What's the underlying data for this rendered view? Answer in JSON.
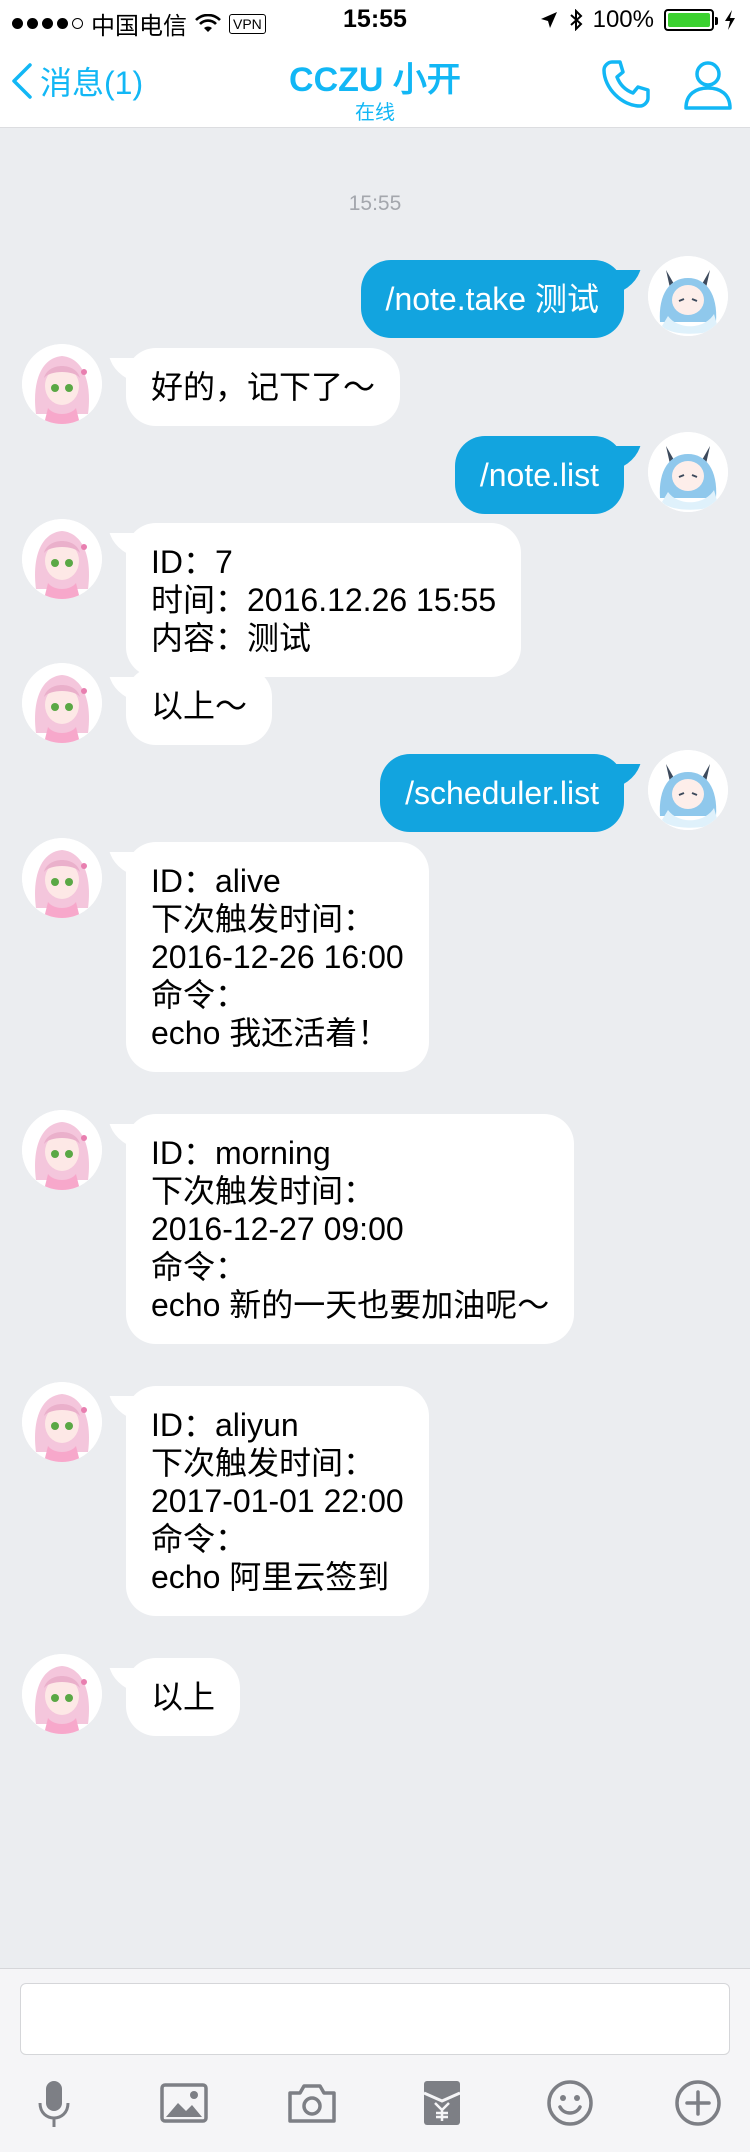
{
  "status_bar": {
    "carrier": "中国电信",
    "vpn": "VPN",
    "time": "15:55",
    "battery": "100%",
    "battery_level": 1.0
  },
  "nav": {
    "back_label": "消息(1)",
    "title": "CCZU 小开",
    "subtitle": "在线"
  },
  "chat": {
    "timestamp": "15:55",
    "messages": [
      {
        "side": "right",
        "text": "/note.take 测试"
      },
      {
        "side": "left",
        "text": "好的，记下了～"
      },
      {
        "side": "right",
        "text": "/note.list"
      },
      {
        "side": "left",
        "text": "ID：7\n时间：2016.12.26 15:55\n内容：测试"
      },
      {
        "side": "left",
        "text": "以上～"
      },
      {
        "side": "right",
        "text": "/scheduler.list"
      },
      {
        "side": "left",
        "text": "ID：alive\n下次触发时间：\n2016-12-26 16:00\n命令：\necho 我还活着！"
      },
      {
        "side": "left",
        "text": "ID：morning\n下次触发时间：\n2016-12-27 09:00\n命令：\necho 新的一天也要加油呢～"
      },
      {
        "side": "left",
        "text": "ID：aliyun\n下次触发时间：\n2017-01-01 22:00\n命令：\necho 阿里云签到"
      },
      {
        "side": "left",
        "text": "以上"
      }
    ]
  },
  "colors": {
    "accent": "#12b7f5",
    "outgoing_bubble": "#12a4df",
    "incoming_bubble": "#ffffff",
    "chat_background": "#ebedf0"
  },
  "toolbar": {
    "icons": [
      "microphone-icon",
      "image-icon",
      "camera-icon",
      "red-packet-icon",
      "emoji-icon",
      "plus-icon"
    ]
  }
}
